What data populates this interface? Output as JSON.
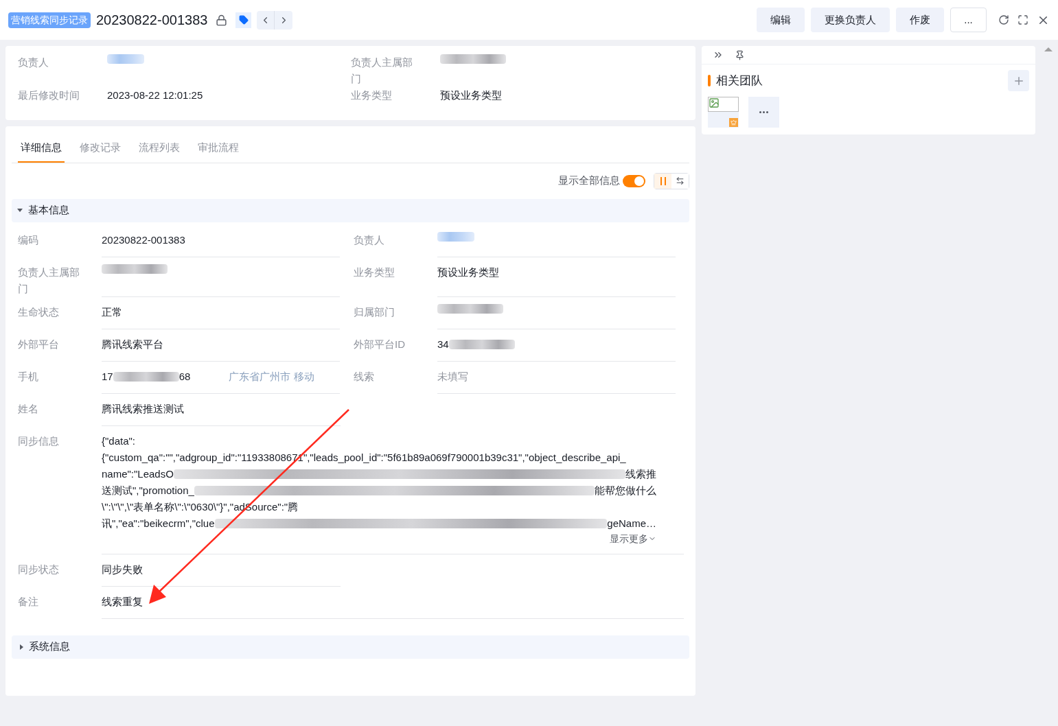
{
  "header": {
    "tag": "营销线索同步记录",
    "title": "20230822-001383",
    "buttons": [
      "编辑",
      "更换负责人",
      "作废",
      "..."
    ]
  },
  "summary": [
    {
      "label": "负责人",
      "value": [
        {
          "kind": "redacted_link"
        }
      ]
    },
    {
      "label": "负责人主属部门",
      "value": [
        {
          "kind": "redacted"
        }
      ]
    },
    {
      "label": "最后修改时间",
      "value": [
        {
          "kind": "text",
          "text": "2023-08-22 12:01:25"
        }
      ]
    },
    {
      "label": "业务类型",
      "value": [
        {
          "kind": "text",
          "text": "预设业务类型"
        }
      ]
    }
  ],
  "tabs": [
    {
      "label": "详细信息",
      "selected": true
    },
    {
      "label": "修改记录",
      "selected": false
    },
    {
      "label": "流程列表",
      "selected": false
    },
    {
      "label": "审批流程",
      "selected": false
    }
  ],
  "show_all": {
    "label": "显示全部信息",
    "on": true
  },
  "layout_toggle": [
    {
      "kind": "columns",
      "selected": true
    },
    {
      "kind": "stretch",
      "selected": false
    }
  ],
  "sections": [
    {
      "title": "基本信息",
      "expanded": true,
      "rows": [
        {
          "kind": "pair",
          "cells": [
            {
              "label": "编码",
              "value": [
                {
                  "kind": "text",
                  "text": "20230822-001383"
                }
              ]
            },
            {
              "label": "负责人",
              "value": [
                {
                  "kind": "redacted_link"
                }
              ]
            }
          ]
        },
        {
          "kind": "pair",
          "cells": [
            {
              "label": "负责人主属部门",
              "value": [
                {
                  "kind": "redacted"
                }
              ]
            },
            {
              "label": "业务类型",
              "value": [
                {
                  "kind": "text",
                  "text": "预设业务类型"
                }
              ]
            }
          ]
        },
        {
          "kind": "pair",
          "cells": [
            {
              "label": "生命状态",
              "value": [
                {
                  "kind": "text",
                  "text": "正常"
                }
              ]
            },
            {
              "label": "归属部门",
              "value": [
                {
                  "kind": "redacted"
                }
              ]
            }
          ]
        },
        {
          "kind": "pair",
          "cells": [
            {
              "label": "外部平台",
              "value": [
                {
                  "kind": "text",
                  "text": "腾讯线索平台"
                }
              ]
            },
            {
              "label": "外部平台ID",
              "value": [
                {
                  "kind": "text",
                  "text": "34"
                },
                {
                  "kind": "redacted"
                }
              ]
            }
          ]
        },
        {
          "kind": "pair",
          "cells": [
            {
              "label": "手机",
              "value": [
                {
                  "kind": "text",
                  "text": "17"
                },
                {
                  "kind": "redacted"
                },
                {
                  "kind": "text",
                  "text": "68"
                },
                {
                  "kind": "location",
                  "text": "广东省广州市 移动"
                }
              ]
            },
            {
              "label": "线索",
              "value": [
                {
                  "kind": "empty",
                  "text": "未填写"
                }
              ]
            }
          ]
        },
        {
          "kind": "single",
          "cells": [
            {
              "label": "姓名",
              "value": [
                {
                  "kind": "text",
                  "text": "腾讯线索推送测试"
                }
              ]
            }
          ]
        },
        {
          "kind": "wide",
          "cells": [
            {
              "label": "同步信息",
              "lines": [
                [
                  {
                    "kind": "text",
                    "text": "{\"data\":"
                  }
                ],
                [
                  {
                    "kind": "text",
                    "text": "{\"custom_qa\":\"\",\"adgroup_id\":\"11933808671\",\"leads_pool_id\":\"5f61b89a069f790001b39c31\",\"object_describe_api_"
                  }
                ],
                [
                  {
                    "kind": "text",
                    "text": "name\":\"LeadsO"
                  },
                  {
                    "kind": "redacted"
                  },
                  {
                    "kind": "text",
                    "text": "线索推"
                  }
                ],
                [
                  {
                    "kind": "text",
                    "text": "送测试\",\"promotion_"
                  },
                  {
                    "kind": "redacted"
                  },
                  {
                    "kind": "text",
                    "text": "能帮您做什么"
                  }
                ],
                [
                  {
                    "kind": "text",
                    "text": "\\\":\\\"\\\",\\\"表单名称\\\":\\\"0630\\\"}\",\"adSource\":\"腾"
                  }
                ],
                [
                  {
                    "kind": "text",
                    "text": "讯\",\"ea\":\"beikecrm\",\"clue"
                  },
                  {
                    "kind": "redacted"
                  },
                  {
                    "kind": "text",
                    "text": "geName…"
                  }
                ]
              ],
              "more": "显示更多"
            }
          ]
        },
        {
          "kind": "single",
          "cells": [
            {
              "label": "同步状态",
              "value": [
                {
                  "kind": "text",
                  "text": "同步失败"
                }
              ]
            }
          ]
        },
        {
          "kind": "wide",
          "cells": [
            {
              "label": "备注",
              "value": [
                {
                  "kind": "text",
                  "text": "线索重复"
                }
              ]
            }
          ]
        }
      ]
    },
    {
      "title": "系统信息",
      "expanded": false
    }
  ],
  "team": {
    "title": "相关团队"
  }
}
